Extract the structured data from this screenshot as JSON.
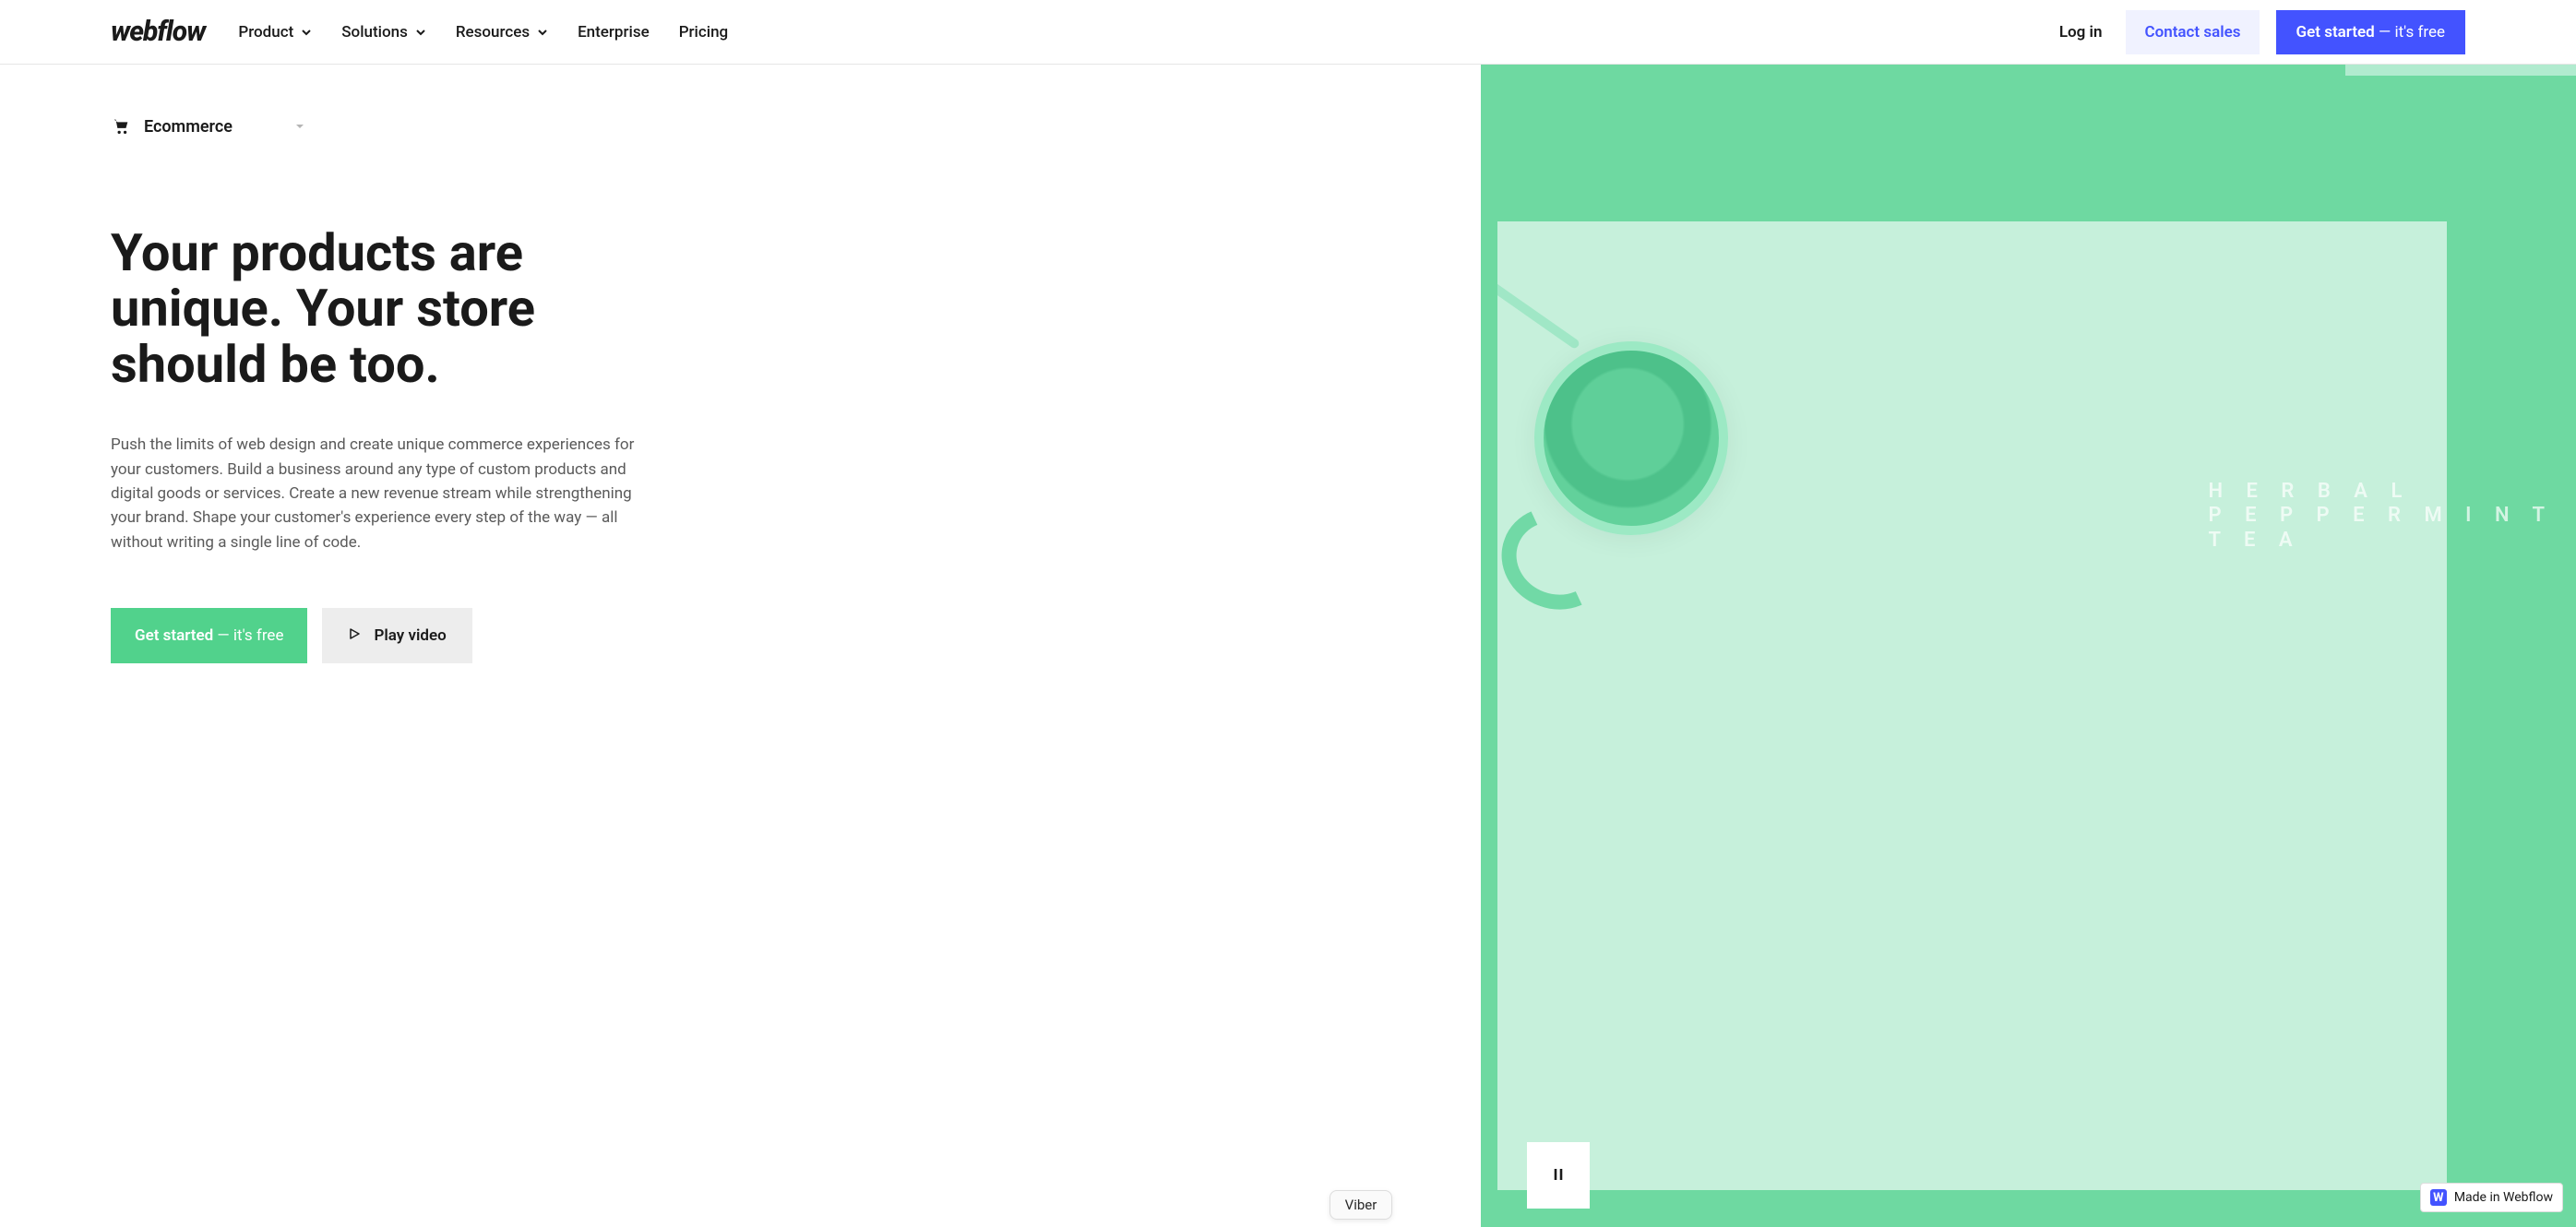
{
  "nav": {
    "logo": "webflow",
    "items": [
      {
        "label": "Product",
        "hasChevron": true
      },
      {
        "label": "Solutions",
        "hasChevron": true
      },
      {
        "label": "Resources",
        "hasChevron": true
      },
      {
        "label": "Enterprise",
        "hasChevron": false
      },
      {
        "label": "Pricing",
        "hasChevron": false
      }
    ],
    "login": "Log in",
    "contact": "Contact sales",
    "getStarted": {
      "label": "Get started",
      "suffix": " — it's free"
    }
  },
  "category": {
    "label": "Ecommerce"
  },
  "hero": {
    "headline": "Your products are unique. Your store should be too.",
    "subhead": "Push the limits of web design and create unique commerce experiences for your customers. Build a business around any type of custom products and digital goods or services. Create a new revenue stream while strengthening your brand. Shape your customer's experience every step of the way — all without writing a single line of code.",
    "cta": {
      "label": "Get started",
      "suffix": " — it's free"
    },
    "video": "Play video",
    "art": {
      "line1": "H E R B A L",
      "line2": "P E P P E R M I N T",
      "line3": "T E A"
    }
  },
  "viber": "Viber",
  "madeIn": "Made in Webflow"
}
